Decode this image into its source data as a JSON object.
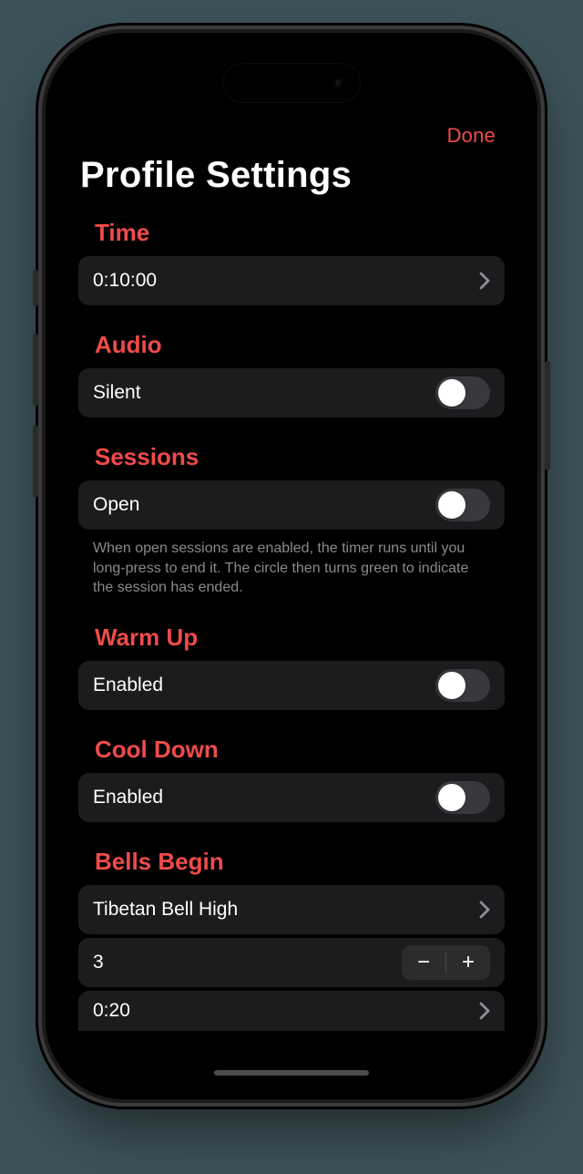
{
  "navbar": {
    "done_label": "Done"
  },
  "page_title": "Profile Settings",
  "sections": {
    "time": {
      "title": "Time",
      "value": "0:10:00"
    },
    "audio": {
      "title": "Audio",
      "label": "Silent",
      "on": false
    },
    "sessions": {
      "title": "Sessions",
      "label": "Open",
      "on": false,
      "note": "When open sessions are enabled, the timer runs until you long-press to end it. The circle then turns green to indicate the session has ended."
    },
    "warmup": {
      "title": "Warm Up",
      "label": "Enabled",
      "on": false
    },
    "cooldown": {
      "title": "Cool Down",
      "label": "Enabled",
      "on": false
    },
    "bells_begin": {
      "title": "Bells Begin",
      "sound": "Tibetan Bell High",
      "count": "3",
      "interval": "0:20"
    }
  },
  "stepper": {
    "minus": "−",
    "plus": "+"
  },
  "colors": {
    "accent": "#ef4b4b",
    "row_bg": "#1c1c1e"
  }
}
